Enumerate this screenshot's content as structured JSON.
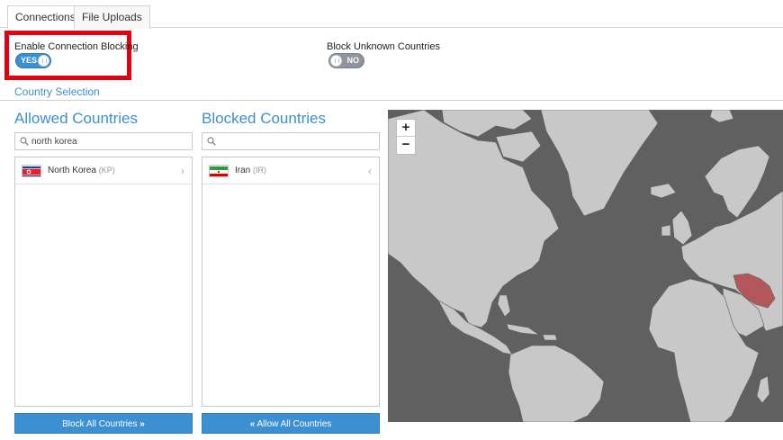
{
  "tabs": [
    {
      "label": "Connections",
      "active": true
    },
    {
      "label": "File Uploads",
      "active": false
    }
  ],
  "settings": {
    "connection_blocking": {
      "label": "Enable Connection Blocking",
      "state": "YES",
      "on": true
    },
    "unknown_countries": {
      "label": "Block Unknown Countries",
      "state": "NO",
      "on": false
    }
  },
  "section_title": "Country Selection",
  "allowed": {
    "title": "Allowed Countries",
    "search_value": "north korea",
    "items": [
      {
        "name": "North Korea",
        "code": "(KP)",
        "flag": "kp-flag-icon"
      }
    ],
    "button_label": "Block All Countries",
    "button_icon": "»"
  },
  "blocked": {
    "title": "Blocked Countries",
    "search_value": "",
    "items": [
      {
        "name": "Iran",
        "code": "(IR)",
        "flag": "ir-flag-icon"
      }
    ],
    "button_label": "Allow All Countries",
    "button_icon": "«"
  },
  "map": {
    "zoom_in": "+",
    "zoom_out": "−",
    "land_color": "#c8c8c8",
    "ocean_color": "#606060",
    "blocked_color": "#b3575a"
  },
  "colors": {
    "accent": "#3c8fd1",
    "highlight": "#e3000f"
  }
}
